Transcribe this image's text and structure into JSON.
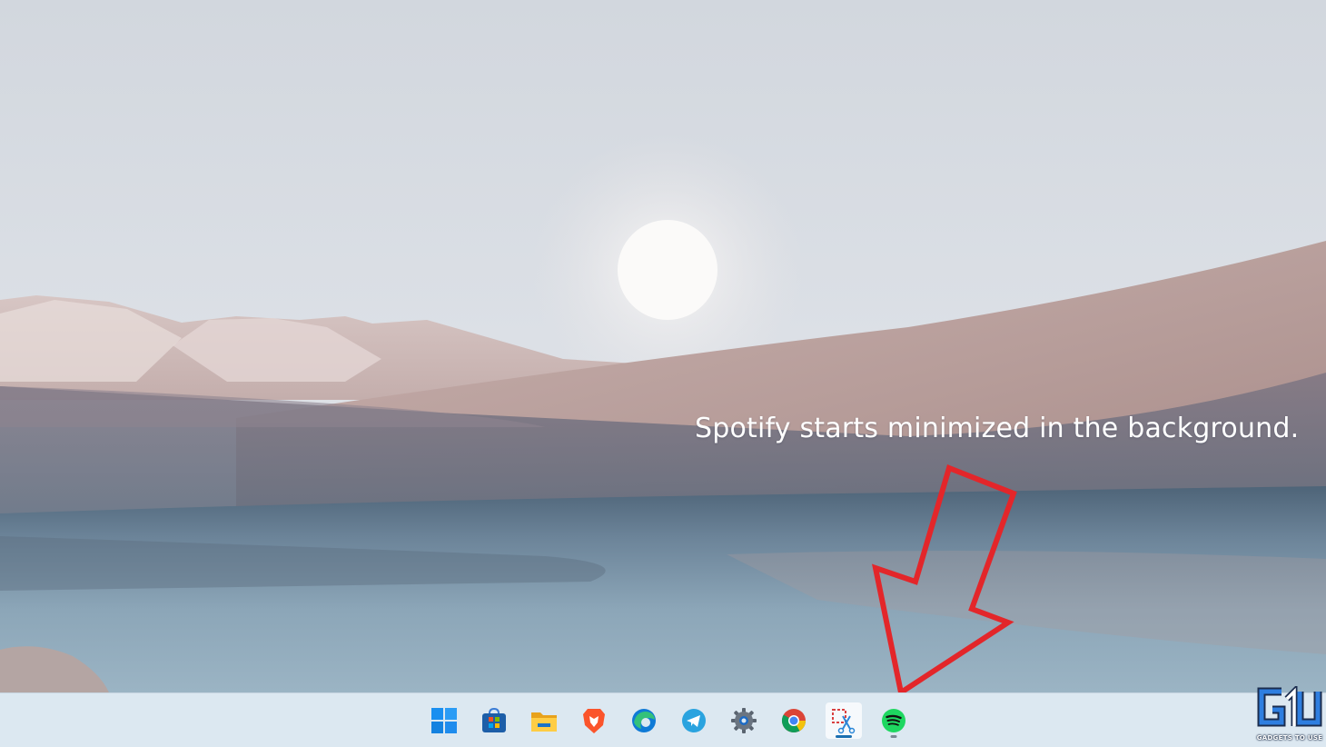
{
  "annotation": {
    "caption": "Spotify starts minimized in the background.",
    "arrow_color": "#e3262a"
  },
  "taskbar": {
    "background": "#dce8f1",
    "items": [
      {
        "name": "start-button",
        "icon": "windows-logo-icon",
        "running": false
      },
      {
        "name": "microsoft-store",
        "icon": "store-bag-icon",
        "running": false
      },
      {
        "name": "file-explorer",
        "icon": "folder-icon",
        "running": false
      },
      {
        "name": "brave-browser",
        "icon": "brave-lion-icon",
        "running": false
      },
      {
        "name": "microsoft-edge",
        "icon": "edge-icon",
        "running": false
      },
      {
        "name": "telegram",
        "icon": "telegram-plane-icon",
        "running": false
      },
      {
        "name": "settings",
        "icon": "gear-icon",
        "running": false
      },
      {
        "name": "google-chrome",
        "icon": "chrome-icon",
        "running": false
      },
      {
        "name": "snipping-tool",
        "icon": "scissors-icon",
        "running": true,
        "active": true
      },
      {
        "name": "spotify",
        "icon": "spotify-icon",
        "running": true,
        "active": false
      }
    ]
  },
  "watermark": {
    "brand": "GADGETS TO USE",
    "logo": "gu-logo-icon"
  }
}
